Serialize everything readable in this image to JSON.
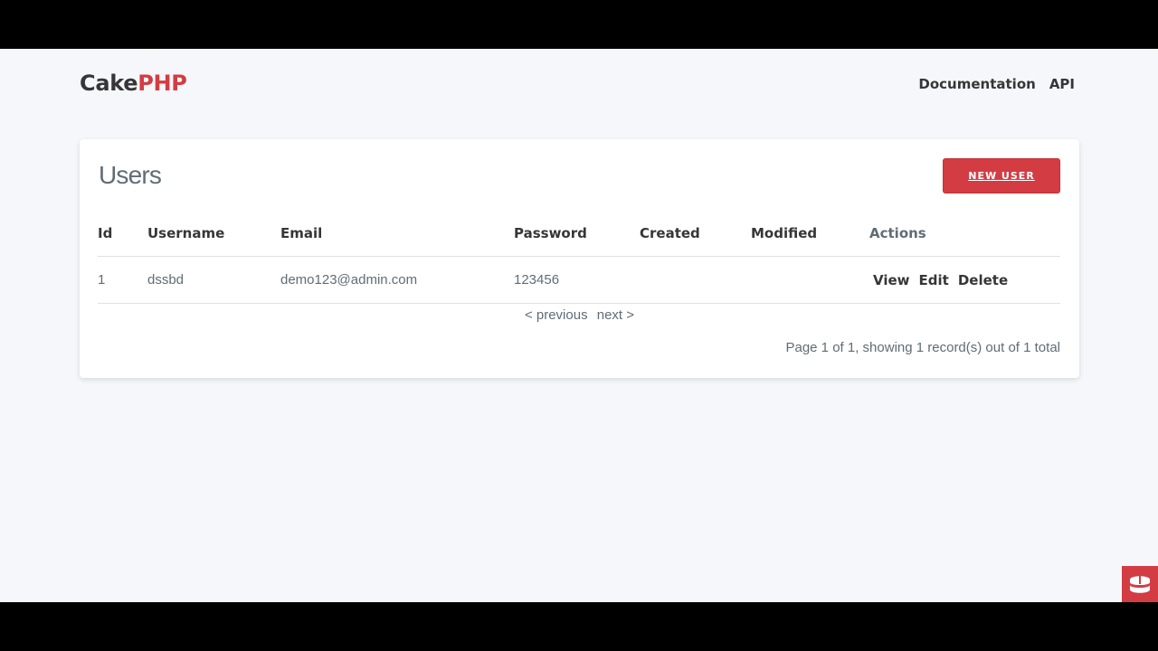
{
  "nav": {
    "brand_part1": "Cake",
    "brand_part2": "PHP",
    "links": [
      "Documentation",
      "API"
    ]
  },
  "users": {
    "title": "Users",
    "new_button": "New User",
    "columns": [
      "Id",
      "Username",
      "Email",
      "Password",
      "Created",
      "Modified",
      "Actions"
    ],
    "rows": [
      {
        "id": "1",
        "username": "dssbd",
        "email": "demo123@admin.com",
        "password": "123456",
        "created": "",
        "modified": "",
        "actions": [
          "View",
          "Edit",
          "Delete"
        ]
      }
    ],
    "pager": {
      "previous": "< previous",
      "next": "next >"
    },
    "counter": "Page 1 of 1, showing 1 record(s) out of 1 total"
  },
  "theme": {
    "accent": "#d33c43",
    "background": "#f5f7fa",
    "text_dark": "#363637",
    "text_muted": "#606c76"
  },
  "icons": {
    "corner_badge": "cakephp-logo-icon"
  }
}
